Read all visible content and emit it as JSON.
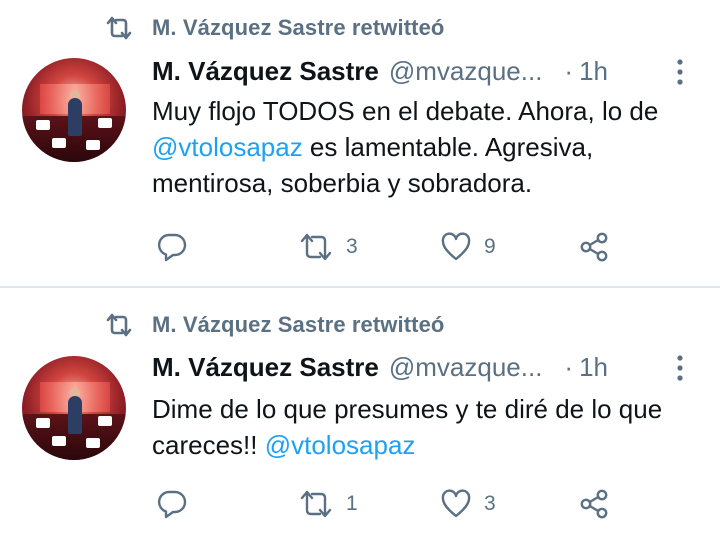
{
  "tweets": [
    {
      "retweet_label": "M. Vázquez Sastre retwitteó",
      "author_name": "M. Vázquez Sastre",
      "author_handle": "@mvazque...",
      "separator": "·",
      "time": "1h",
      "text_before": "Muy flojo TODOS en el debate. Ahora, lo de ",
      "mention": "@vtolosapaz",
      "text_after": " es lamentable. Agresiva, mentirosa, soberbia y sobradora.",
      "replies": "",
      "retweets": "3",
      "likes": "9"
    },
    {
      "retweet_label": "M. Vázquez Sastre retwitteó",
      "author_name": "M. Vázquez Sastre",
      "author_handle": "@mvazque...",
      "separator": "·",
      "time": "1h",
      "text_before": "Dime de lo que presumes y te diré de lo que careces!! ",
      "mention": "@vtolosapaz",
      "text_after": "",
      "replies": "",
      "retweets": "1",
      "likes": "3"
    }
  ],
  "colors": {
    "muted": "#5b7083",
    "link": "#1da1f2",
    "text": "#0f1419",
    "divider": "#e1e8ed"
  },
  "icons": [
    "retweet-icon",
    "reply-icon",
    "like-icon",
    "share-icon",
    "more-icon"
  ]
}
